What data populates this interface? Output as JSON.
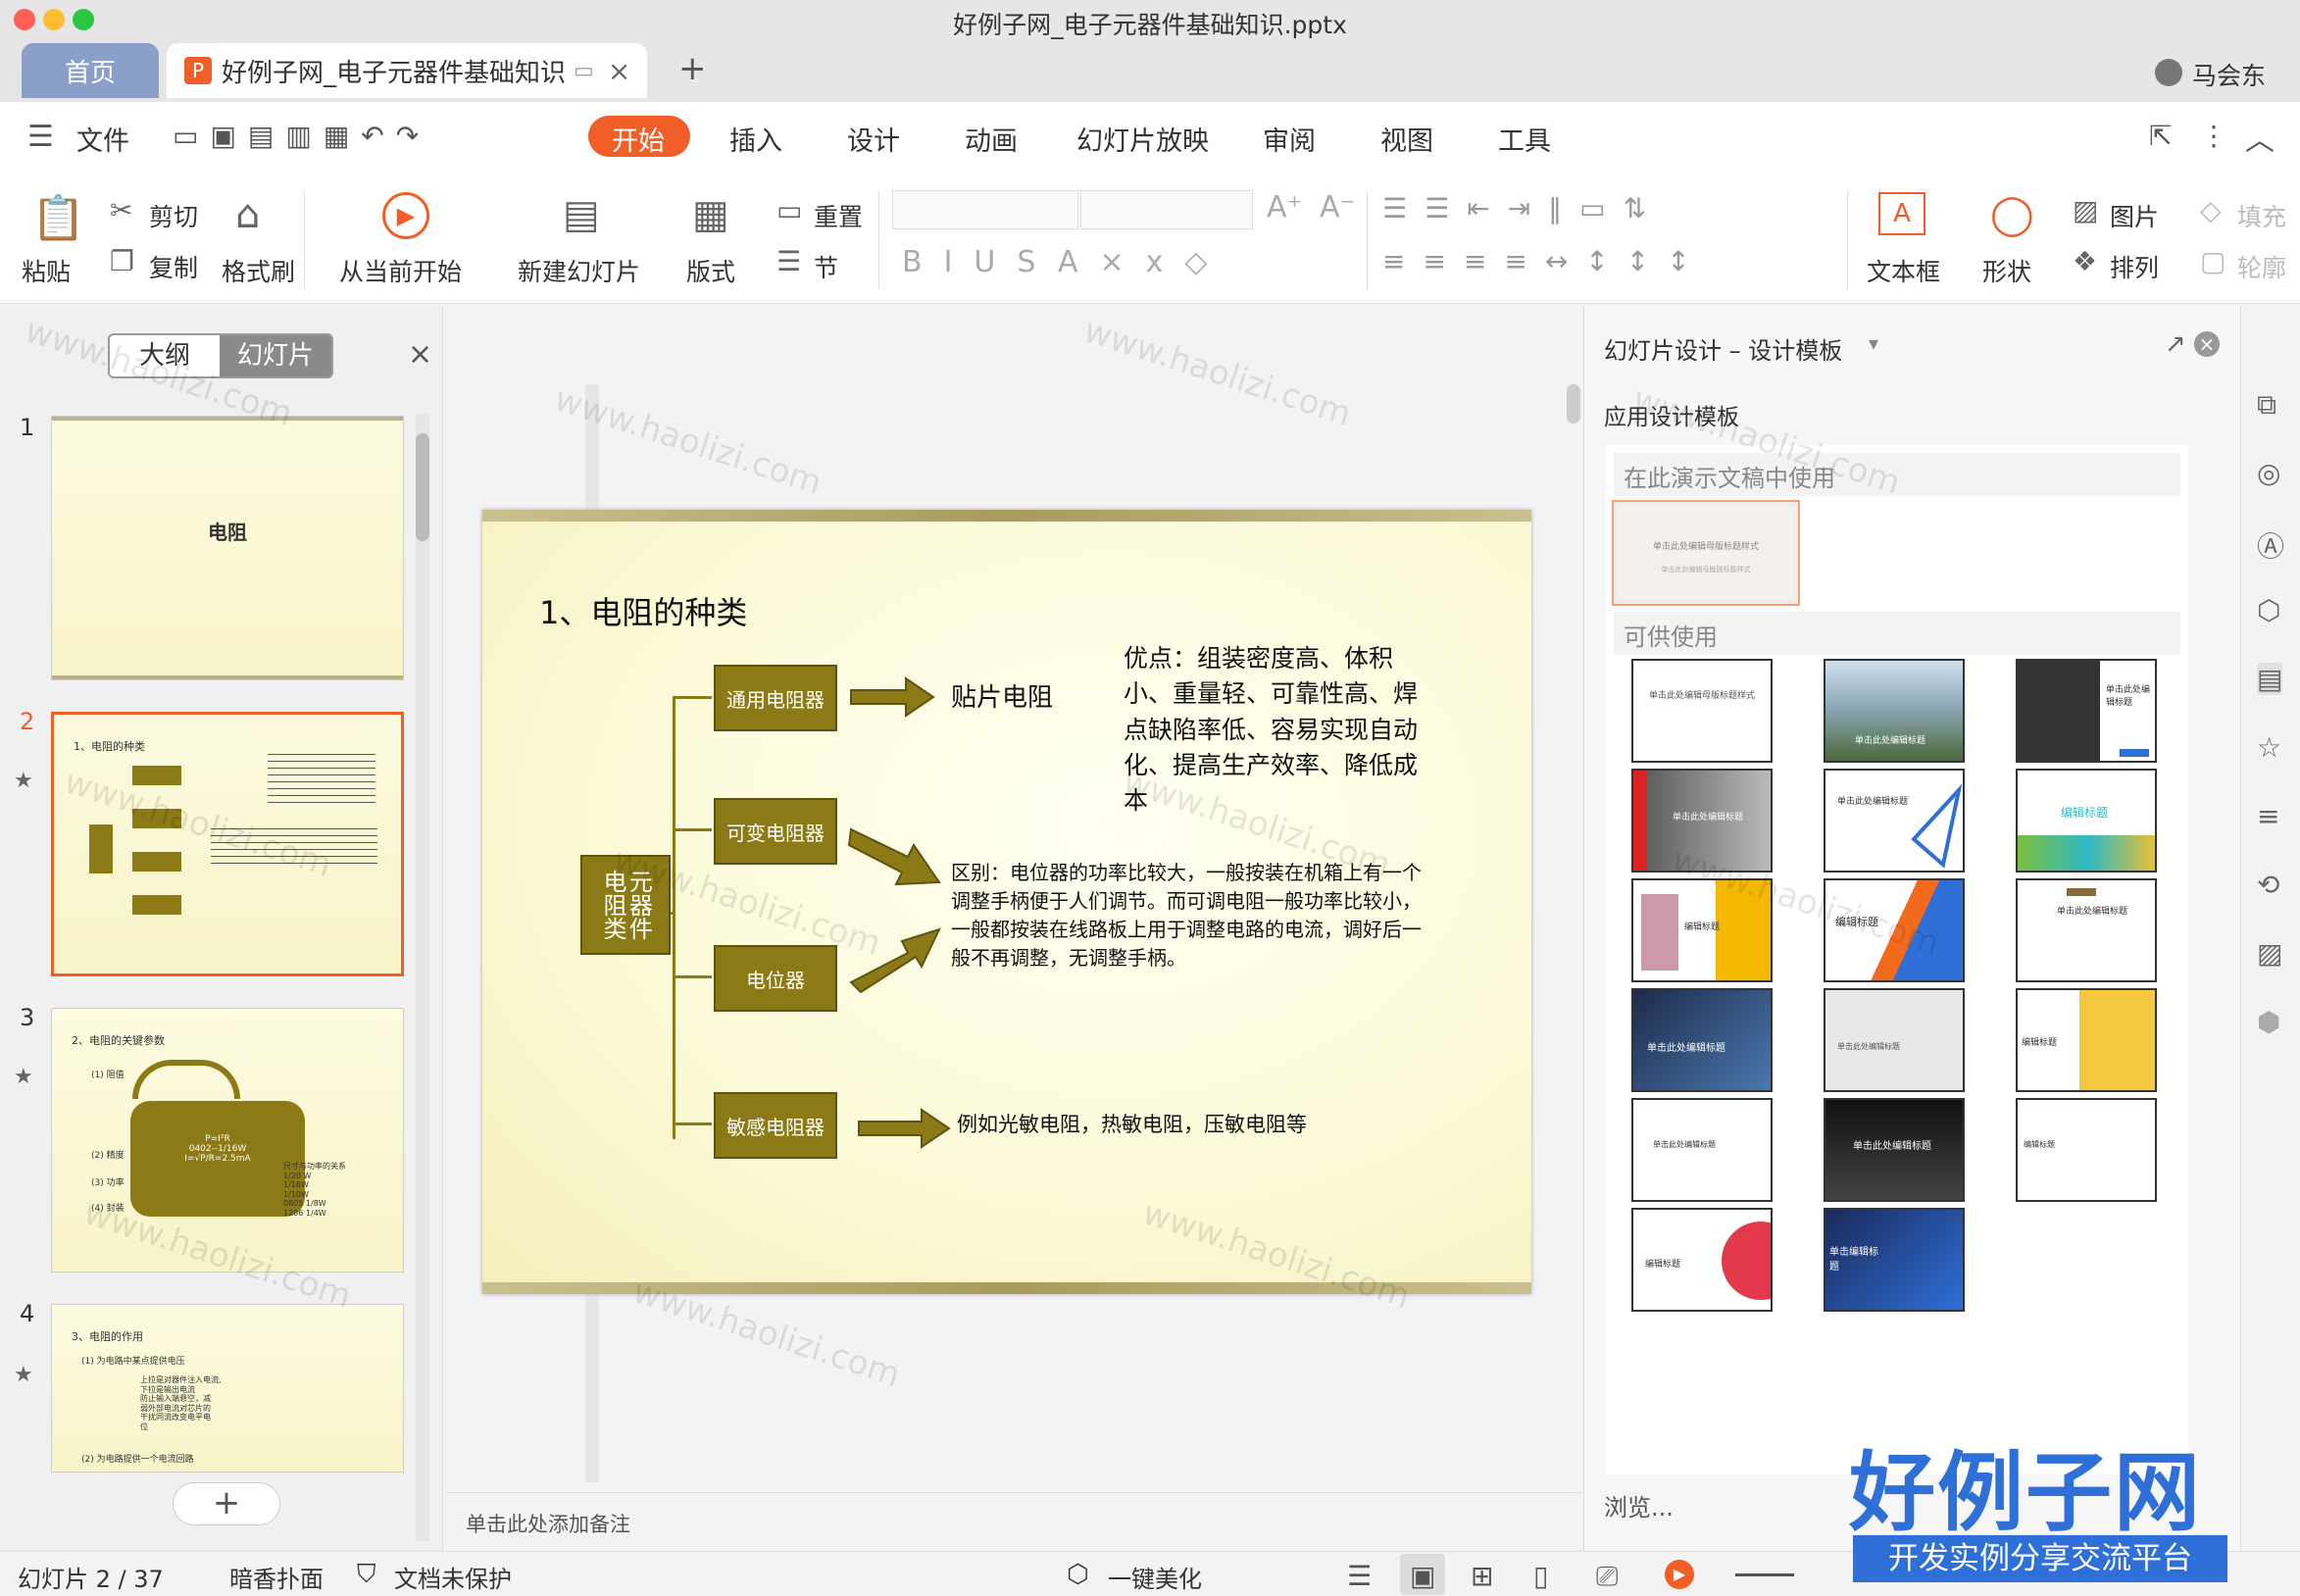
{
  "window": {
    "title": "好例子网_电子元器件基础知识.pptx"
  },
  "tabs": {
    "home": "首页",
    "doc": "好例子网_电子元器件基础知识",
    "user": "马会东"
  },
  "menu": [
    "文件",
    "开始",
    "插入",
    "设计",
    "动画",
    "幻灯片放映",
    "审阅",
    "视图",
    "工具"
  ],
  "ribbon": {
    "paste": "粘贴",
    "cut": "剪切",
    "copy": "复制",
    "format_brush": "格式刷",
    "play_from": "从当前开始",
    "new_slide": "新建幻灯片",
    "layout": "版式",
    "reset": "重置",
    "section": "节",
    "textbox": "文本框",
    "shape": "形状",
    "picture": "图片",
    "arrange": "排列",
    "fill": "填充",
    "outline": "轮廓"
  },
  "left_panel": {
    "tab_outline": "大纲",
    "tab_slides": "幻灯片",
    "add": "+"
  },
  "thumbs": [
    {
      "num": "1",
      "title": "电阻"
    },
    {
      "num": "2",
      "title": "1、电阻的种类"
    },
    {
      "num": "3",
      "title": "2、电阻的关键参数",
      "l1": "(1) 阻值",
      "l2": "(2) 精度",
      "l3": "(3) 功率",
      "l4": "(4) 封装",
      "blob": "P=I²R\n0402--1/16W\nI=√P/R=2.5mA",
      "table": "尺寸与功率的关系\n1/20 W\n1/16W\n1/10W\n0805  1/8W\n1206  1/4W"
    },
    {
      "num": "4",
      "title": "3、电阻的作用",
      "l1": "(1) 为电路中某点提供电压",
      "l2": "上拉是对器件注入电流,\n下拉是输出电流\n防止输入端悬空，减\n弱外部电流对芯片的\n干扰同流改变电平电\n位",
      "l3": "(2) 为电路提供一个电流回路"
    }
  ],
  "slide": {
    "title": "1、电阻的种类",
    "root": "元器件\n电阻类",
    "b1": "通用电阻器",
    "b2": "可变电阻器",
    "b3": "电位器",
    "b4": "敏感电阻器",
    "t_smd": "贴片电阻",
    "t_adv": "优点：组装密度高、体积小、重量轻、可靠性高、焊点缺陷率低、容易实现自动化、提高生产效率、降低成本",
    "t_diff": "区别：电位器的功率比较大，一般按装在机箱上有一个调整手柄便于人们调节。而可调电阻一般功率比较小，一般都按装在线路板上用于调整电路的电流，调好后一般不再调整，无调整手柄。",
    "t_sens": "例如光敏电阻，热敏电阻，压敏电阻等"
  },
  "notes": "单击此处添加备注",
  "right_panel": {
    "title": "幻灯片设计 – 设计模板",
    "apply": "应用设计模板",
    "in_use": "在此演示文稿中使用",
    "available": "可供使用",
    "browse": "浏览...",
    "current_tpl": "单击此处编辑母版标题样式",
    "current_sub": "单击此处编辑母版副标题样式",
    "tpls": [
      "单击此处编辑母版标题样式",
      "单击此处编辑标题",
      "单击此处编辑标题",
      "单击此处编辑标题",
      "单击此处编辑标题",
      "编辑标题",
      "编辑标题",
      "编辑标题",
      "单击此处编辑标题",
      "单击此处编辑标题",
      "单击此处编辑标题",
      "编辑标题",
      "单击此处编辑标题",
      "单击此处编辑标题",
      "编辑标题",
      "编辑标题",
      "单击编辑标题"
    ]
  },
  "status": {
    "slide": "幻灯片 2 / 37",
    "theme": "暗香扑面",
    "protect": "文档未保护",
    "beautify": "一键美化"
  },
  "watermark": {
    "site": "www.haolizi.com",
    "logo": "好例子网",
    "slogan": "开发实例分享交流平台"
  },
  "colors": {
    "accent": "#f25e28",
    "olive": "#8b7a16",
    "blue": "#2f6fd8"
  }
}
